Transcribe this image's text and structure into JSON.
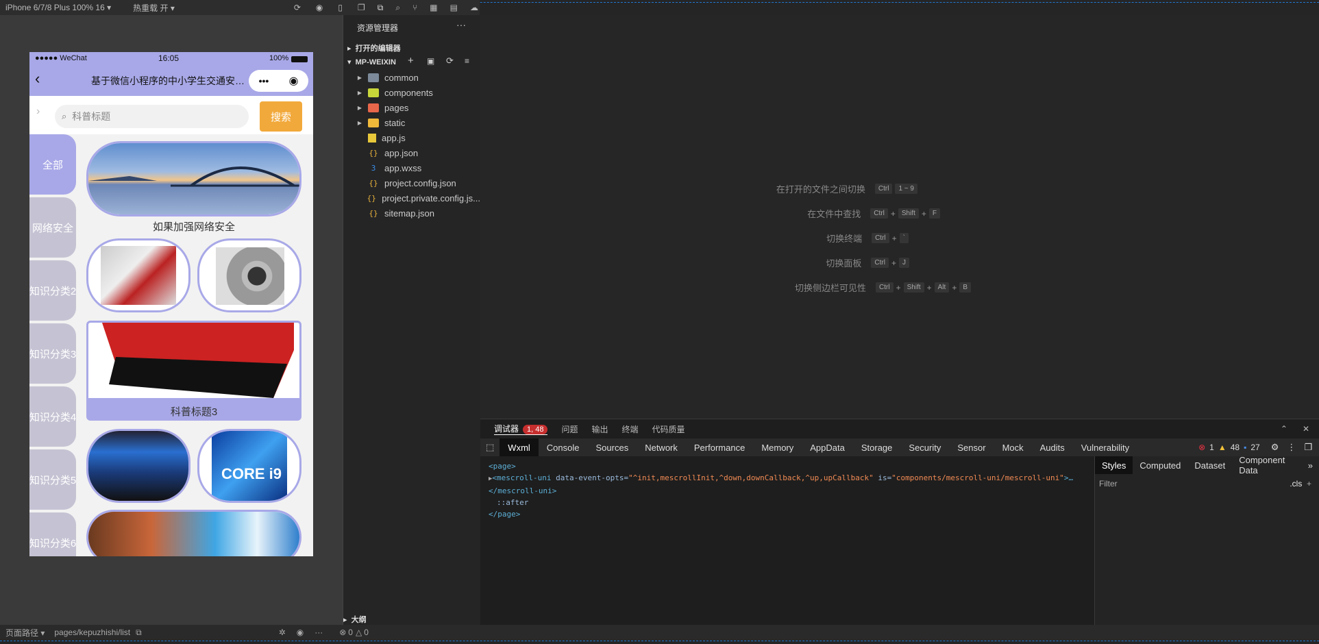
{
  "toolbar": {
    "device": "iPhone 6/7/8 Plus 100% 16",
    "hot_reload": "热重载 开"
  },
  "phone": {
    "carrier": "●●●●● WeChat",
    "time": "16:05",
    "battery": "100%",
    "nav_title": "基于微信小程序的中小学生交通安全...",
    "search_placeholder": "科普标题",
    "search_button": "搜索",
    "categories": [
      "全部",
      "网络安全",
      "知识分类2",
      "知识分类3",
      "知识分类4",
      "知识分类5",
      "知识分类6"
    ],
    "cards": {
      "card1_caption": "如果加强网络安全",
      "card3_caption": "科普标题3"
    }
  },
  "explorer": {
    "title": "资源管理器",
    "open_editors": "打开的编辑器",
    "project": "MP-WEIXIN",
    "items": [
      {
        "name": "common",
        "kind": "folder"
      },
      {
        "name": "components",
        "kind": "folder"
      },
      {
        "name": "pages",
        "kind": "folder"
      },
      {
        "name": "static",
        "kind": "folder"
      },
      {
        "name": "app.js",
        "kind": "js"
      },
      {
        "name": "app.json",
        "kind": "json"
      },
      {
        "name": "app.wxss",
        "kind": "wxss"
      },
      {
        "name": "project.config.json",
        "kind": "json"
      },
      {
        "name": "project.private.config.js...",
        "kind": "json"
      },
      {
        "name": "sitemap.json",
        "kind": "json"
      }
    ],
    "outline": "大纲"
  },
  "editor_hints": [
    {
      "label": "在打开的文件之间切换",
      "keys": [
        "Ctrl",
        "1 ~ 9"
      ]
    },
    {
      "label": "在文件中查找",
      "keys": [
        "Ctrl",
        "+",
        "Shift",
        "+",
        "F"
      ]
    },
    {
      "label": "切换终端",
      "keys": [
        "Ctrl",
        "+",
        "`"
      ]
    },
    {
      "label": "切换面板",
      "keys": [
        "Ctrl",
        "+",
        "J"
      ]
    },
    {
      "label": "切换侧边栏可见性",
      "keys": [
        "Ctrl",
        "+",
        "Shift",
        "+",
        "Alt",
        "+",
        "B"
      ]
    }
  ],
  "debugger": {
    "tabs": [
      "调试器",
      "问题",
      "输出",
      "终端",
      "代码质量"
    ],
    "badge": "1, 48",
    "devtools_tabs": [
      "Wxml",
      "Console",
      "Sources",
      "Network",
      "Performance",
      "Memory",
      "AppData",
      "Storage",
      "Security",
      "Sensor",
      "Mock",
      "Audits",
      "Vulnerability"
    ],
    "errors": "1",
    "warnings": "48",
    "infos": "27",
    "wxml": {
      "line1": "<page>",
      "tag_open": "<mescroll-uni",
      "attr1": " data-event-opts=",
      "val1": "\"^init,mescrollInit,^down,downCallback,^up,upCallback\"",
      "attr2": " is=",
      "val2": "\"components/mescroll-uni/mescroll-uni\"",
      "tag_close_bracket": ">…",
      "line3": "</mescroll-uni>",
      "line4": "::after",
      "line5": "</page>"
    },
    "side_tabs": [
      "Styles",
      "Computed",
      "Dataset",
      "Component Data"
    ],
    "filter": "Filter",
    "cls": ".cls"
  },
  "status": {
    "page_path_label": "页面路径",
    "page_path": "pages/kepuzhishi/list",
    "err_count": "0",
    "warn_count": "0"
  }
}
